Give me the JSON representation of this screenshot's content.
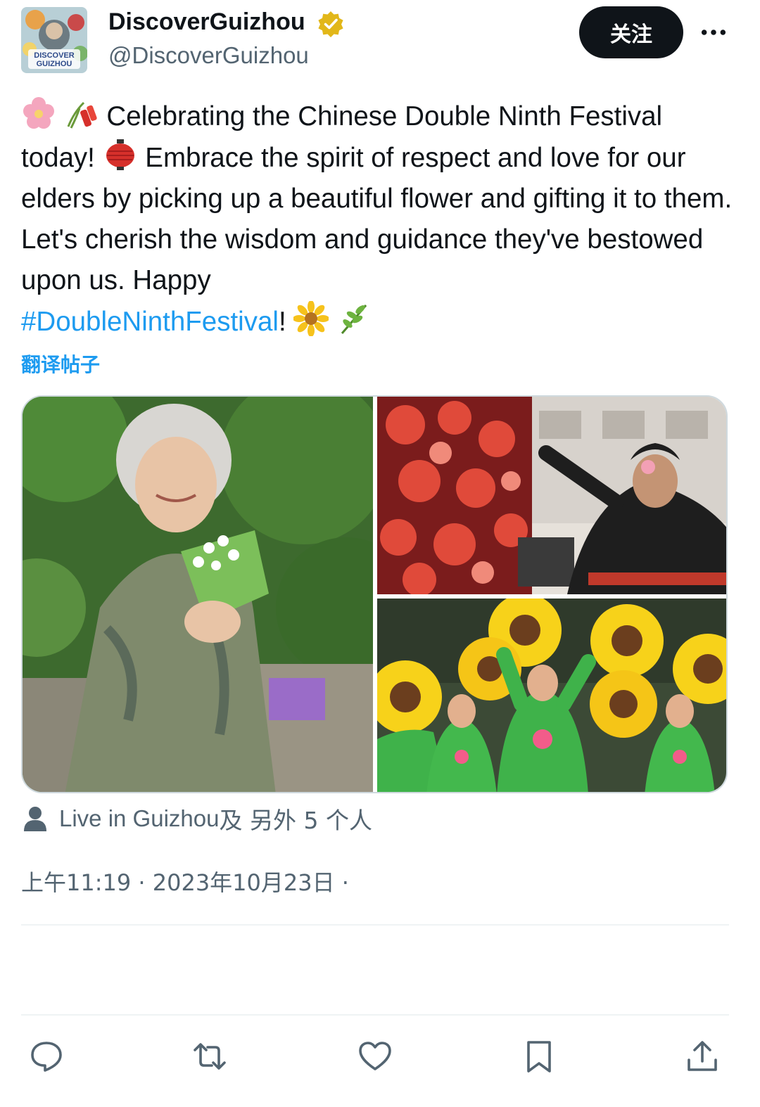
{
  "author": {
    "name": "DiscoverGuizhou",
    "handle": "@DiscoverGuizhou",
    "verified": true,
    "verified_color": "#e2b719",
    "avatar_text": [
      "DISCOVER",
      "GUIZHOU"
    ]
  },
  "follow_button": "关注",
  "more_icon": "more-horizontal-icon",
  "tweet": {
    "lead_emojis": [
      "cherry-blossom-emoji",
      "firecracker-emoji"
    ],
    "text_part1": "Celebrating the Chinese Double Ninth Festival today!",
    "mid_emoji": "red-lantern-emoji",
    "text_part2": "Embrace the spirit of respect and love for our elders by picking up a beautiful flower and gifting it to them. Let's cherish the wisdom and guidance they've bestowed upon us. Happy",
    "hashtag": "#DoubleNinthFestival",
    "exclamation": "!",
    "trail_emojis": [
      "sunflower-emoji",
      "herb-emoji"
    ]
  },
  "translate_link": "翻译帖子",
  "media": [
    {
      "name": "elderly-woman-with-flowers-photo"
    },
    {
      "name": "woman-with-red-paper-flowers-photo"
    },
    {
      "name": "dancers-with-sunflower-props-photo"
    }
  ],
  "tagged": {
    "icon": "person-icon",
    "first": "Live in Guizhou",
    "rest": " 及 另外 5 个人"
  },
  "timestamp": "上午11:19 · 2023年10月23日 ·",
  "actions": [
    {
      "name": "reply-icon"
    },
    {
      "name": "retweet-icon"
    },
    {
      "name": "like-icon"
    },
    {
      "name": "bookmark-icon"
    },
    {
      "name": "share-icon"
    }
  ],
  "colors": {
    "link": "#1d9bf0",
    "secondary_text": "#536471",
    "primary_text": "#0f1419",
    "divider": "#eff3f4"
  }
}
